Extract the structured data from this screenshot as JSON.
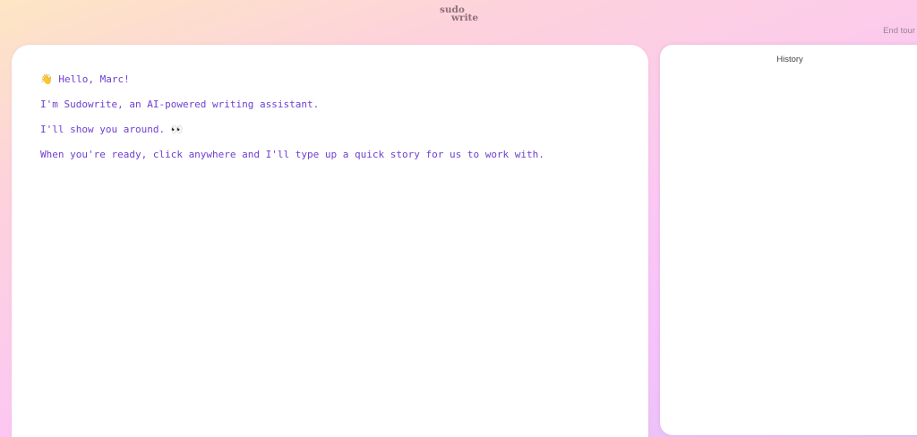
{
  "logo": {
    "line1": "sudo",
    "line2": "write"
  },
  "header": {
    "end_tour_label": "End tour"
  },
  "editor": {
    "lines": [
      "👋 Hello, Marc!",
      "I'm Sudowrite, an AI-powered writing assistant.",
      "I'll show you around. 👀",
      "When you're ready, click anywhere and I'll type up a quick story for us to work with."
    ]
  },
  "history": {
    "title": "History"
  },
  "colors": {
    "accent_text": "#6f3fd0",
    "panel_bg": "#ffffff",
    "logo": "#8e6f7a"
  }
}
